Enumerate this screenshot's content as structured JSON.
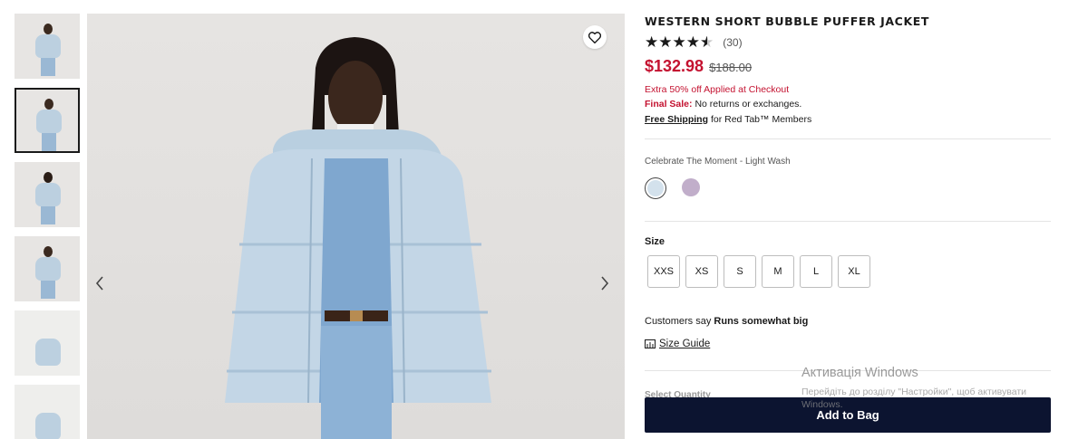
{
  "gallery": {
    "thumbnails": [
      {
        "alt": "",
        "active": false
      },
      {
        "alt": "",
        "active": true
      },
      {
        "alt": "",
        "active": false
      },
      {
        "alt": "",
        "active": false
      },
      {
        "alt": "",
        "active": false
      },
      {
        "alt": "",
        "active": false
      }
    ],
    "icons": {
      "wishlist": "heart-outline-icon",
      "prev": "chevron-left-icon",
      "next": "chevron-right-icon"
    }
  },
  "product": {
    "title": "WESTERN SHORT BUBBLE PUFFER JACKET",
    "rating": {
      "stars": 4.5,
      "max": 5,
      "count_text": "(30)"
    },
    "price": "$132.98",
    "original_price": "$188.00",
    "promo": "Extra 50% off Applied at Checkout",
    "final_sale_label": "Final Sale:",
    "final_sale_text": "No returns or exchanges.",
    "shipping_link": "Free Shipping",
    "shipping_text": "for Red Tab™ Members",
    "color_name": "Celebrate The Moment - Light Wash",
    "colors": [
      "#d3e1ec",
      "#c1aeca"
    ],
    "size_label": "Size",
    "sizes": [
      "XXS",
      "XS",
      "S",
      "M",
      "L",
      "XL"
    ],
    "fit_prefix": "Customers say",
    "fit_value": "Runs somewhat big",
    "size_guide": "Size Guide",
    "quantity_label": "Select Quantity",
    "add_to_bag": "Add to Bag",
    "accent_color": "#c41230",
    "button_color": "#0c1430"
  },
  "watermark": {
    "title": "Активація Windows",
    "subtitle": "Перейдіть до розділу \"Настройки\", щоб активувати Windows."
  }
}
